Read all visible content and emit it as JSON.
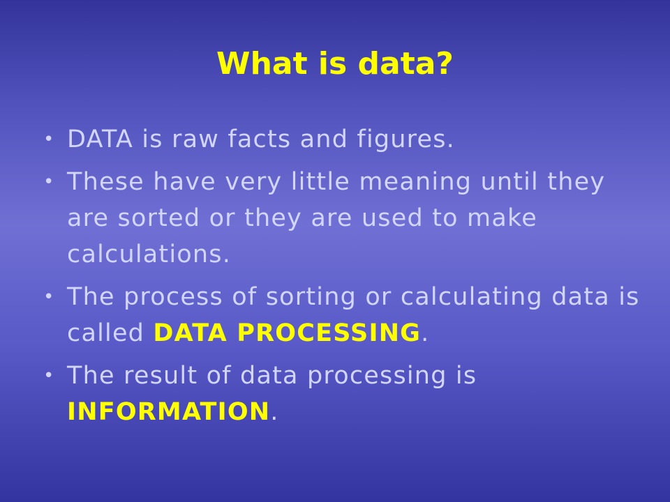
{
  "slide": {
    "title": "What is data?",
    "bullets": [
      {
        "text": "DATA is raw facts and figures."
      },
      {
        "text": "These have very little meaning until they are sorted or they are used to make calculations."
      },
      {
        "text_before": "The process of sorting or calculating data is called ",
        "highlight": "DATA PROCESSING",
        "text_after": "."
      },
      {
        "text_before": "The result of data processing is ",
        "highlight": "INFORMATION",
        "text_after": "."
      }
    ],
    "bullet_glyph": "•"
  },
  "colors": {
    "title": "#ffff00",
    "body_text": "#d2d6ff",
    "highlight": "#ffff00",
    "background_top": "#33339b",
    "background_mid": "#6f6fd4",
    "background_bottom": "#3434a0"
  }
}
